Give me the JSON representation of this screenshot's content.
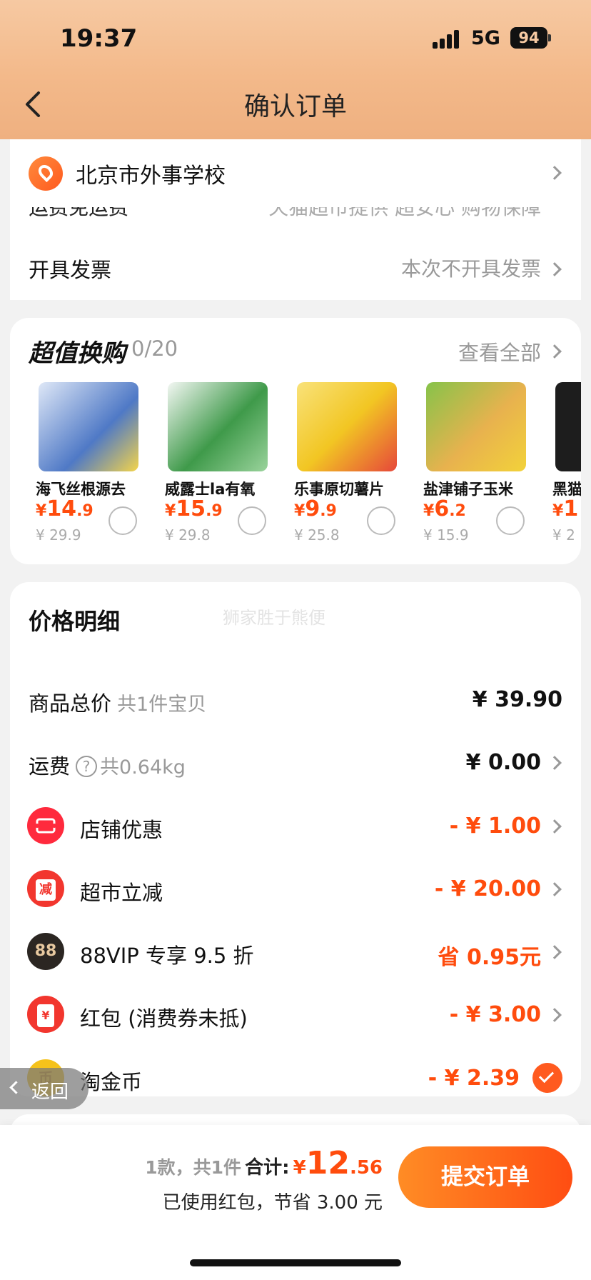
{
  "status_bar": {
    "time": "19:37",
    "network": "5G",
    "battery": "94"
  },
  "header": {
    "title": "确认订单"
  },
  "address": {
    "text": "北京市外事学校"
  },
  "shipping": {
    "label": "运费免运费",
    "value": "天猫超市提供 超安心 购物保障"
  },
  "invoice": {
    "label": "开具发票",
    "value": "本次不开具发票"
  },
  "deals": {
    "title": "超值换购",
    "count": "0/20",
    "view_all": "查看全部",
    "items": [
      {
        "name": "海飞丝根源去",
        "currency": "¥",
        "price_int": "14",
        "price_dec": ".9",
        "original": "¥ 29.9",
        "image": "shampoo-bottles",
        "color": "#4f79c6"
      },
      {
        "name": "威露士la有氧",
        "currency": "¥",
        "price_int": "15",
        "price_dec": ".9",
        "original": "¥ 29.8",
        "image": "laundry-detergent",
        "color": "#3f9a4a"
      },
      {
        "name": "乐事原切薯片",
        "currency": "¥",
        "price_int": "9",
        "price_dec": ".9",
        "original": "¥ 25.8",
        "image": "potato-chips",
        "color": "#f2c623"
      },
      {
        "name": "盐津铺子玉米",
        "currency": "¥",
        "price_int": "6",
        "price_dec": ".2",
        "original": "¥ 15.9",
        "image": "corn-snack",
        "color": "#86c34a"
      },
      {
        "name": "黑猫",
        "currency": "¥",
        "price_int": "1",
        "price_dec": "",
        "original": "¥ 2",
        "image": "black-package",
        "color": "#1d1d1d"
      }
    ]
  },
  "price_detail": {
    "title": "价格明细",
    "watermark": "狮家胜于熊便",
    "goods_total": {
      "label": "商品总价",
      "sub": "共1件宝贝",
      "value": "¥ 39.90"
    },
    "freight": {
      "label": "运费",
      "help": "?",
      "sub": "共0.64kg",
      "value": "¥ 0.00"
    },
    "store_discount": {
      "label": "店铺优惠",
      "value": "- ¥ 1.00",
      "icon": "ticket-icon",
      "color": "#ff2a3d"
    },
    "market_cut": {
      "label": "超市立减",
      "value": "- ¥ 20.00",
      "icon_text": "减",
      "color": "#f2362e"
    },
    "vip": {
      "label": "88VIP 专享 9.5 折",
      "value": "省 0.95元",
      "icon_text": "88",
      "color": "#2b2622"
    },
    "red_packet": {
      "label": "红包 (消费券未抵)",
      "value": "- ¥ 3.00",
      "icon_text": "¥",
      "color": "#f2362e"
    },
    "gold_coin": {
      "label": "淘金币",
      "value": "- ¥ 2.39",
      "icon_text": "币",
      "color": "#f5c21b"
    }
  },
  "float_back": {
    "label": "返回"
  },
  "bottom": {
    "count": "1款，共1件",
    "total_label": "合计:",
    "currency": "¥",
    "total_int": "12",
    "total_dec": ".56",
    "saved": "已使用红包，节省 3.00 元",
    "submit": "提交订单"
  }
}
